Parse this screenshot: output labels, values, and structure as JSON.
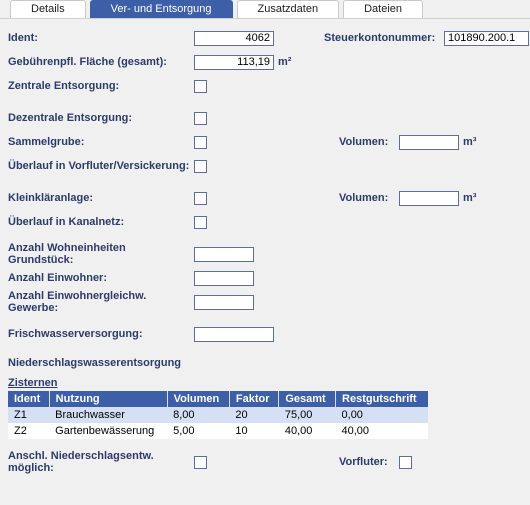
{
  "tabs": [
    "Details",
    "Ver- und Entsorgung",
    "Zusatzdaten",
    "Dateien"
  ],
  "active_tab": 1,
  "fields": {
    "ident_label": "Ident:",
    "ident_value": "4062",
    "steuerkonto_label": "Steuerkontonummer:",
    "steuerkonto_value": "101890.200.1",
    "flaeche_label": "Gebührenpfl. Fläche (gesamt):",
    "flaeche_value": "113,19",
    "flaeche_unit": "m²",
    "zentrale_label": "Zentrale Entsorgung:",
    "dezentrale_label": "Dezentrale Entsorgung:",
    "sammelgrube_label": "Sammelgrube:",
    "volumen_label": "Volumen:",
    "volumen_unit": "m³",
    "ueberlauf_vorfluter_label": "Überlauf in Vorfluter/Versickerung:",
    "kleinklaer_label": "Kleinkläranlage:",
    "ueberlauf_kanal_label": "Überlauf in Kanalnetz:",
    "wohneinheiten_label": "Anzahl Wohneinheiten Grundstück:",
    "einwohner_label": "Anzahl Einwohner:",
    "einwohnergleich_label": "Anzahl Einwohnergleichw. Gewerbe:",
    "frischwasser_label": "Frischwasserversorgung:",
    "niederschlag_title": "Niederschlagswasserentsorgung",
    "zisternen_link": "Zisternen",
    "anschl_label": "Anschl. Niederschlagsentw. möglich:",
    "vorfluter_label": "Vorfluter:"
  },
  "zisternen": {
    "headers": [
      "Ident",
      "Nutzung",
      "Volumen",
      "Faktor",
      "Gesamt",
      "Restgutschrift"
    ],
    "rows": [
      {
        "ident": "Z1",
        "nutzung": "Brauchwasser",
        "volumen": "8,00",
        "faktor": "20",
        "gesamt": "75,00",
        "rest": "0,00"
      },
      {
        "ident": "Z2",
        "nutzung": "Gartenbewässerung",
        "volumen": "5,00",
        "faktor": "10",
        "gesamt": "40,00",
        "rest": "40,00"
      }
    ]
  }
}
